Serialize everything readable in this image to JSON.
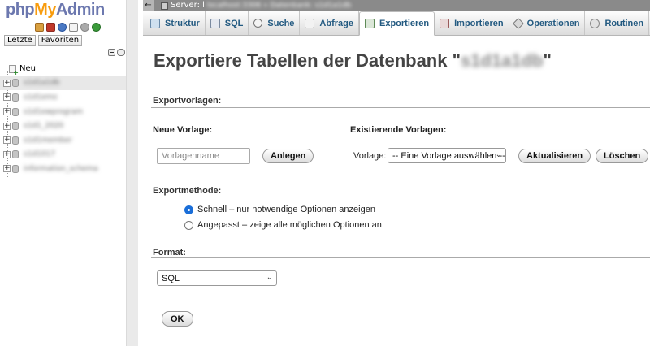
{
  "app": {
    "logo": {
      "php": "php",
      "my": "My",
      "admin": "Admin"
    },
    "brand_colors": {
      "php": "#6c78af",
      "my": "#f89c0e",
      "link": "#235a81"
    }
  },
  "nav": {
    "icons": [
      "home-icon",
      "exit-icon",
      "help-icon",
      "docs-icon",
      "settings-icon",
      "reload-icon"
    ],
    "buttons": {
      "recent": "Letzte",
      "favorites": "Favoriten"
    },
    "new_item": "Neu",
    "databases": [
      {
        "name": "s1d1a1db"
      },
      {
        "name": "s1d1emo"
      },
      {
        "name": "s1d1ewprogram"
      },
      {
        "name": "s1d1_2020"
      },
      {
        "name": "s1d1member"
      },
      {
        "name": "s1d1017"
      },
      {
        "name": "information_schema"
      }
    ]
  },
  "topbar": {
    "server_label": "Server: l",
    "server_detail": "localhost:3306 » Datenbank: s1d1a1db"
  },
  "tabs": [
    {
      "label": "Struktur",
      "icon": "structure-icon"
    },
    {
      "label": "SQL",
      "icon": "sql-icon"
    },
    {
      "label": "Suche",
      "icon": "search-icon"
    },
    {
      "label": "Abfrage",
      "icon": "query-icon"
    },
    {
      "label": "Exportieren",
      "icon": "export-icon",
      "active": true
    },
    {
      "label": "Importieren",
      "icon": "import-icon"
    },
    {
      "label": "Operationen",
      "icon": "operations-icon"
    },
    {
      "label": "Routinen",
      "icon": "routines-icon"
    }
  ],
  "main": {
    "title_prefix": "Exportiere Tabellen der Datenbank \"",
    "title_db": "s1d1a1db",
    "title_suffix": "\"",
    "templates": {
      "heading": "Exportvorlagen:",
      "new_label": "Neue Vorlage:",
      "name_placeholder": "Vorlagenname",
      "create_button": "Anlegen",
      "existing_label": "Existierende Vorlagen:",
      "template_label": "Vorlage:",
      "template_select": "-- Eine Vorlage auswählen --",
      "update_button": "Aktualisieren",
      "delete_button": "Löschen"
    },
    "method": {
      "heading": "Exportmethode:",
      "options": [
        {
          "label": "Schnell – nur notwendige Optionen anzeigen",
          "checked": true
        },
        {
          "label": "Angepasst – zeige alle möglichen Optionen an",
          "checked": false
        }
      ]
    },
    "format": {
      "heading": "Format:",
      "selected": "SQL"
    },
    "ok_button": "OK"
  }
}
